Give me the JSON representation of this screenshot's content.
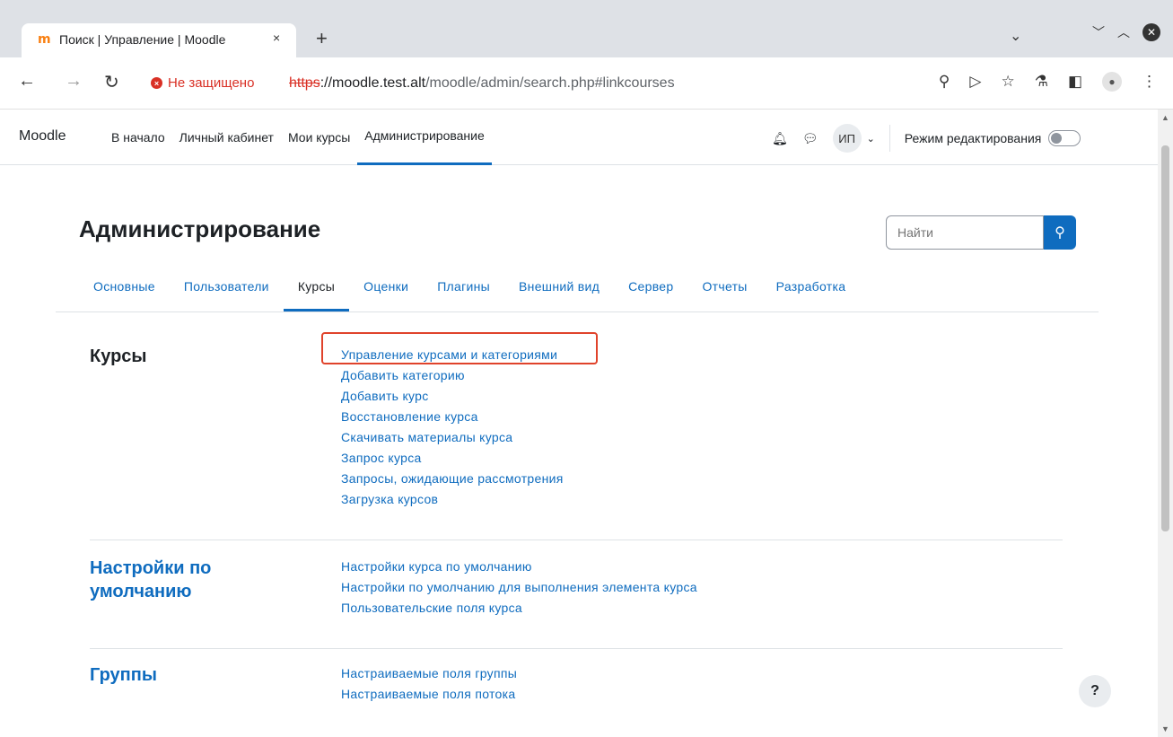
{
  "browser": {
    "tab_title": "Поиск | Управление | Moodle",
    "tab_close": "×",
    "new_tab": "+",
    "security_label": "Не защищено",
    "url_scheme": "https",
    "url_host": "://moodle.test.alt",
    "url_path": "/moodle/admin/search.php#linkcourses"
  },
  "navbar": {
    "brand": "Moodle",
    "items": [
      {
        "label": "В начало"
      },
      {
        "label": "Личный кабинет"
      },
      {
        "label": "Мои курсы"
      },
      {
        "label": "Администрирование"
      }
    ],
    "avatar_initials": "ИП",
    "edit_mode_label": "Режим редактирования"
  },
  "page": {
    "title": "Администрирование",
    "search_placeholder": "Найти",
    "tabs": [
      {
        "label": "Основные"
      },
      {
        "label": "Пользователи"
      },
      {
        "label": "Курсы"
      },
      {
        "label": "Оценки"
      },
      {
        "label": "Плагины"
      },
      {
        "label": "Внешний вид"
      },
      {
        "label": "Сервер"
      },
      {
        "label": "Отчеты"
      },
      {
        "label": "Разработка"
      }
    ],
    "sections": [
      {
        "title": "Курсы",
        "links": [
          "Управление курсами и категориями",
          "Добавить категорию",
          "Добавить курс",
          "Восстановление курса",
          "Скачивать материалы курса",
          "Запрос курса",
          "Запросы, ожидающие рассмотрения",
          "Загрузка курсов"
        ]
      },
      {
        "title_line1": "Настройки по",
        "title_line2": "умолчанию",
        "links": [
          "Настройки курса по умолчанию",
          "Настройки по умолчанию для выполнения элемента курса",
          "Пользовательские поля курса"
        ]
      },
      {
        "title": "Группы",
        "links": [
          "Настраиваемые поля группы",
          "Настраиваемые поля потока"
        ]
      }
    ],
    "help_label": "?"
  },
  "colors": {
    "link": "#0f6cbf",
    "highlight": "#e0432b",
    "text": "#1d2125"
  }
}
